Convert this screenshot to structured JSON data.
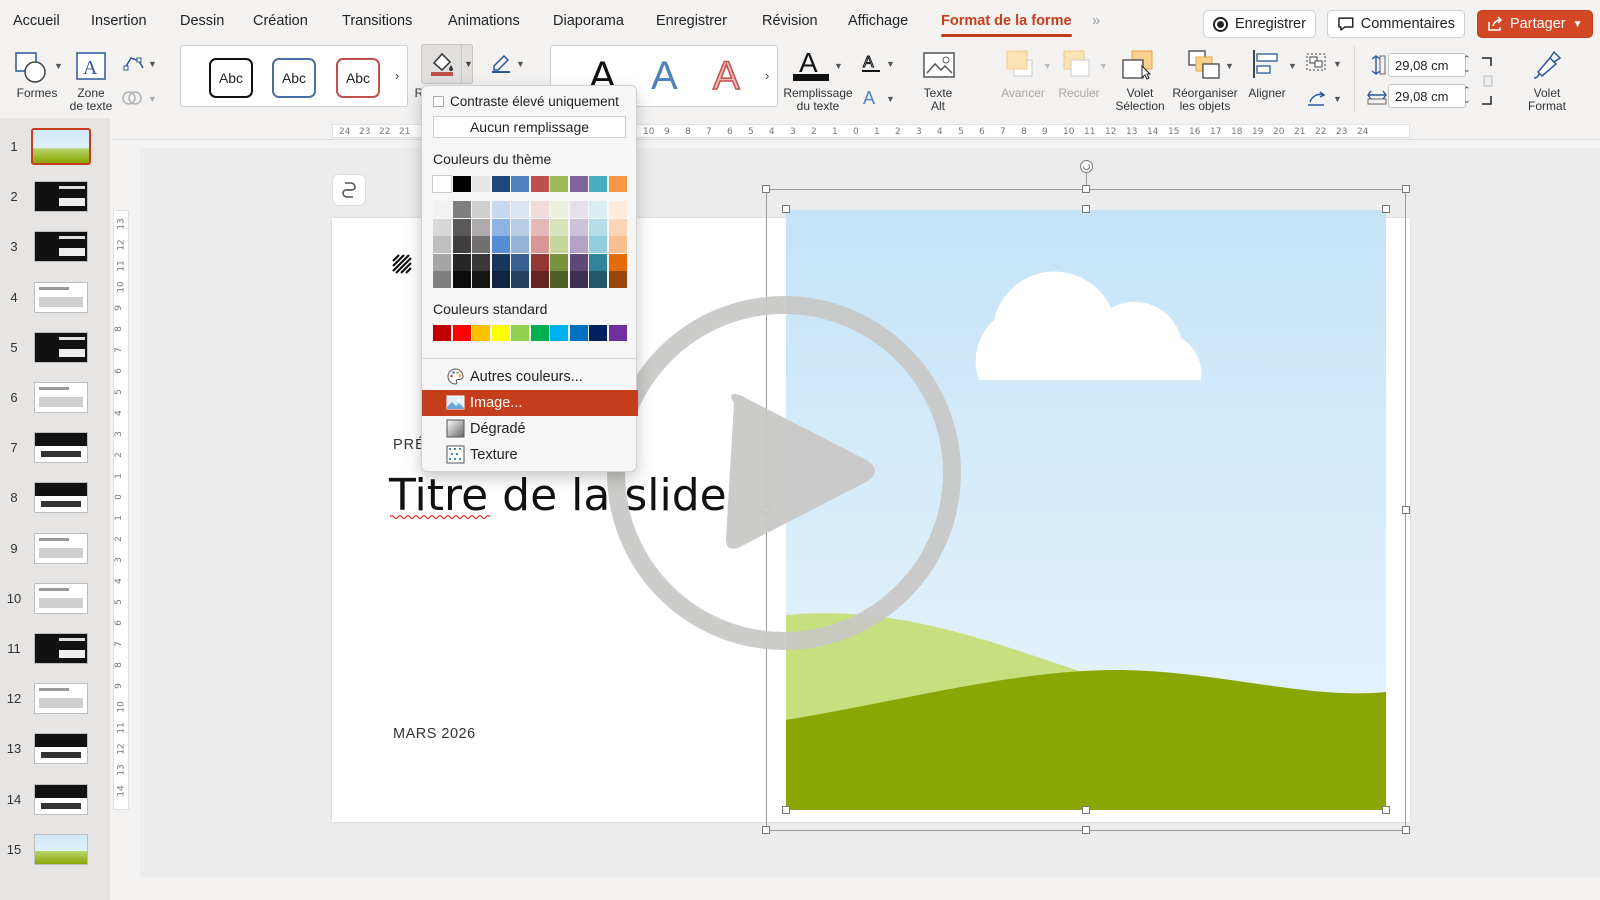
{
  "tabs": [
    "Accueil",
    "Insertion",
    "Dessin",
    "Création",
    "Transitions",
    "Animations",
    "Diaporama",
    "Enregistrer",
    "Révision",
    "Affichage",
    "Format de la forme"
  ],
  "active_tab": "Format de la forme",
  "top_buttons": {
    "record": "Enregistrer",
    "comments": "Commentaires",
    "share": "Partager"
  },
  "ribbon": {
    "shapes": "Formes",
    "textbox_line1": "Zone",
    "textbox_line2": "de texte",
    "style_samples": [
      "Abc",
      "Abc",
      "Abc"
    ],
    "fill_partial_label": "Re",
    "text_fill_line1": "Remplissage",
    "text_fill_line2": "du texte",
    "alt_text_line1": "Texte",
    "alt_text_line2": "Alt",
    "bring_forward": "Avancer",
    "send_backward": "Reculer",
    "selection_pane_line1": "Volet",
    "selection_pane_line2": "Sélection",
    "arrange_line1": "Réorganiser",
    "arrange_line2": "les objets",
    "align": "Aligner",
    "height": "29,08 cm",
    "width": "29,08 cm",
    "format_pane_line1": "Volet",
    "format_pane_line2": "Format"
  },
  "ruler_ticks": [
    "24",
    "23",
    "22",
    "21",
    "10",
    "9",
    "8",
    "7",
    "6",
    "5",
    "4",
    "3",
    "2",
    "1",
    "0",
    "1",
    "2",
    "3",
    "4",
    "5",
    "6",
    "7",
    "8",
    "9",
    "10",
    "11",
    "12",
    "13",
    "14",
    "15",
    "16",
    "17",
    "18",
    "19",
    "20",
    "21",
    "22",
    "23",
    "24"
  ],
  "vruler_ticks": [
    "13",
    "12",
    "11",
    "10",
    "9",
    "8",
    "7",
    "6",
    "5",
    "4",
    "3",
    "2",
    "1",
    "0",
    "1",
    "2",
    "3",
    "4",
    "5",
    "6",
    "7",
    "8",
    "9",
    "10",
    "11",
    "12",
    "13",
    "14"
  ],
  "slides": [
    {
      "num": "1",
      "theme": "landscape"
    },
    {
      "num": "2",
      "theme": "dark"
    },
    {
      "num": "3",
      "theme": "dark"
    },
    {
      "num": "4",
      "theme": "light"
    },
    {
      "num": "5",
      "theme": "dark"
    },
    {
      "num": "6",
      "theme": "light"
    },
    {
      "num": "7",
      "theme": "mixed"
    },
    {
      "num": "8",
      "theme": "mixed"
    },
    {
      "num": "9",
      "theme": "light"
    },
    {
      "num": "10",
      "theme": "light"
    },
    {
      "num": "11",
      "theme": "dark"
    },
    {
      "num": "12",
      "theme": "light"
    },
    {
      "num": "13",
      "theme": "mixed"
    },
    {
      "num": "14",
      "theme": "mixed"
    },
    {
      "num": "15",
      "theme": "landscape"
    }
  ],
  "selected_slide": "1",
  "slide": {
    "label_partial": "PRÉ",
    "title": "Titre de la slide",
    "date": "MARS 2026"
  },
  "menu": {
    "high_contrast": "Contraste élevé uniquement",
    "no_fill": "Aucun remplissage",
    "theme_colors_heading": "Couleurs du thème",
    "standard_colors_heading": "Couleurs standard",
    "theme_colors": [
      "#ffffff",
      "#000000",
      "#e7e6e6",
      "#1f497d",
      "#4f81bd",
      "#c0504d",
      "#9bbb59",
      "#8064a2",
      "#4bacc6",
      "#f79646"
    ],
    "theme_shades": [
      [
        "#f2f2f2",
        "#7f7f7f",
        "#d0cece",
        "#c6d9f0",
        "#dbe5f1",
        "#f2dcdb",
        "#ebf1dd",
        "#e5e0ec",
        "#dbeef3",
        "#fdeada"
      ],
      [
        "#d8d8d8",
        "#595959",
        "#aeaaaa",
        "#8db3e2",
        "#b8cce4",
        "#e5b9b7",
        "#d7e3bc",
        "#ccc1d9",
        "#b7dde8",
        "#fbd5b5"
      ],
      [
        "#bfbfbf",
        "#3f3f3f",
        "#757070",
        "#548dd4",
        "#95b3d7",
        "#d99694",
        "#c3d69b",
        "#b2a2c7",
        "#92cddc",
        "#fac08f"
      ],
      [
        "#a5a5a5",
        "#262626",
        "#3a3838",
        "#17365d",
        "#366092",
        "#953734",
        "#76923c",
        "#5f497a",
        "#31859b",
        "#e36c09"
      ],
      [
        "#7f7f7f",
        "#0c0c0c",
        "#171616",
        "#0f243e",
        "#244061",
        "#632423",
        "#4f6128",
        "#3f3151",
        "#205867",
        "#974806"
      ]
    ],
    "standard_colors": [
      "#c00000",
      "#ff0000",
      "#ffc000",
      "#ffff00",
      "#92d050",
      "#00b050",
      "#00b0f0",
      "#0070c0",
      "#002060",
      "#7030a0"
    ],
    "more_colors": "Autres couleurs...",
    "image": "Image...",
    "gradient": "Dégradé",
    "texture": "Texture"
  }
}
